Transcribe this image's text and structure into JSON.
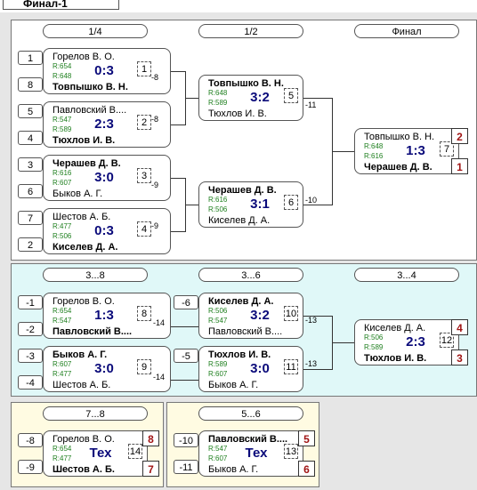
{
  "title": "Финал-1",
  "headers": {
    "r14": "1/4",
    "r12": "1/2",
    "final": "Финал",
    "c38": "3...8",
    "c36": "3...6",
    "c34": "3...4",
    "c78": "7...8",
    "c56": "5...6"
  },
  "seeds": {
    "m1a": "1",
    "m1b": "8",
    "m2a": "5",
    "m2b": "4",
    "m3a": "3",
    "m3b": "6",
    "m4a": "7",
    "m4b": "2",
    "c1a": "-1",
    "c1b": "-2",
    "c2a": "-3",
    "c2b": "-4",
    "c3": "-6",
    "c4": "-5",
    "c5a": "-8",
    "c5b": "-9",
    "c6a": "-10",
    "c6b": "-11"
  },
  "matches": {
    "m1": {
      "p1": "Горелов В. О.",
      "r1": "R:654",
      "r2": "R:648",
      "p2": "Товпышко В. Н.",
      "score": "0:3",
      "num": "1",
      "out": "-8"
    },
    "m2": {
      "p1": "Павловский В....",
      "r1": "R:547",
      "r2": "R:589",
      "p2": "Тюхлов И. В.",
      "score": "2:3",
      "num": "2",
      "out": "-8"
    },
    "m3": {
      "p1": "Черашев Д. В.",
      "r1": "R:616",
      "r2": "R:607",
      "p2": "Быков А. Г.",
      "score": "3:0",
      "num": "3",
      "out": "-9"
    },
    "m4": {
      "p1": "Шестов А. Б.",
      "r1": "R:477",
      "r2": "R:506",
      "p2": "Киселев Д. А.",
      "score": "0:3",
      "num": "4",
      "out": "-9"
    },
    "m5": {
      "p1": "Товпышко В. Н.",
      "r1": "R:648",
      "r2": "R:589",
      "p2": "Тюхлов И. В.",
      "score": "3:2",
      "num": "5",
      "out": "-11"
    },
    "m6": {
      "p1": "Черашев Д. В.",
      "r1": "R:616",
      "r2": "R:506",
      "p2": "Киселев Д. А.",
      "score": "3:1",
      "num": "6",
      "out": "-10"
    },
    "m7": {
      "p1": "Товпышко В. Н.",
      "r1": "R:648",
      "r2": "R:616",
      "p2": "Черашев Д. В.",
      "score": "1:3",
      "num": "7",
      "place1": "2",
      "place2": "1"
    },
    "m8": {
      "p1": "Горелов В. О.",
      "r1": "R:654",
      "r2": "R:547",
      "p2": "Павловский В....",
      "score": "1:3",
      "num": "8",
      "out": "-14"
    },
    "m9": {
      "p1": "Быков А. Г.",
      "r1": "R:607",
      "r2": "R:477",
      "p2": "Шестов А. Б.",
      "score": "3:0",
      "num": "9",
      "out": "-14"
    },
    "m10": {
      "p1": "Киселев Д. А.",
      "r1": "R:506",
      "r2": "R:547",
      "p2": "Павловский В....",
      "score": "3:2",
      "num": "10",
      "out": "-13"
    },
    "m11": {
      "p1": "Тюхлов И. В.",
      "r1": "R:589",
      "r2": "R:607",
      "p2": "Быков А. Г.",
      "score": "3:0",
      "num": "11",
      "out": "-13"
    },
    "m12": {
      "p1": "Киселев Д. А.",
      "r1": "R:506",
      "r2": "R:589",
      "p2": "Тюхлов И. В.",
      "score": "2:3",
      "num": "12",
      "place1": "4",
      "place2": "3"
    },
    "m14": {
      "p1": "Горелов В. О.",
      "r1": "R:654",
      "r2": "R:477",
      "p2": "Шестов А. Б.",
      "score": "Тех",
      "num": "14",
      "place1": "8",
      "place2": "7"
    },
    "m13": {
      "p1": "Павловский В....",
      "r1": "R:547",
      "r2": "R:607",
      "p2": "Быков А. Г.",
      "score": "Тех",
      "num": "13",
      "place1": "5",
      "place2": "6"
    }
  }
}
